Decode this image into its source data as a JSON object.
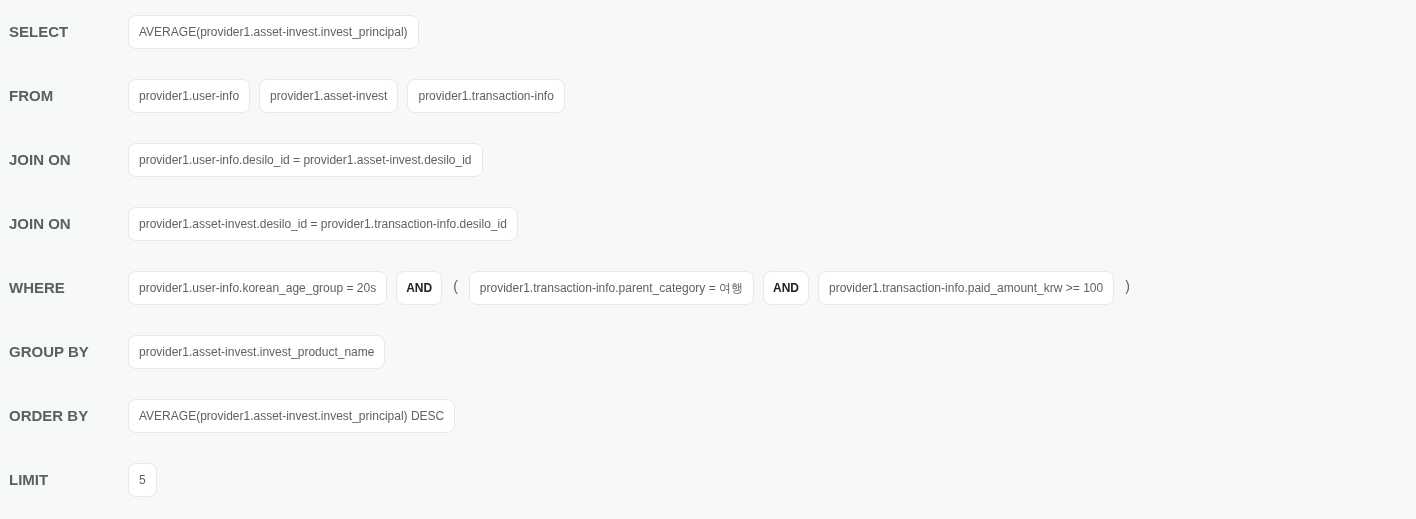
{
  "clauses": [
    {
      "keyword": "SELECT",
      "items": [
        {
          "kind": "chip",
          "text": "AVERAGE(provider1.asset-invest.invest_principal)"
        }
      ]
    },
    {
      "keyword": "FROM",
      "items": [
        {
          "kind": "chip",
          "text": "provider1.user-info"
        },
        {
          "kind": "chip",
          "text": "provider1.asset-invest"
        },
        {
          "kind": "chip",
          "text": "provider1.transaction-info"
        }
      ]
    },
    {
      "keyword": "JOIN ON",
      "items": [
        {
          "kind": "chip",
          "text": "provider1.user-info.desilo_id = provider1.asset-invest.desilo_id"
        }
      ]
    },
    {
      "keyword": "JOIN ON",
      "items": [
        {
          "kind": "chip",
          "text": "provider1.asset-invest.desilo_id = provider1.transaction-info.desilo_id"
        }
      ]
    },
    {
      "keyword": "WHERE",
      "items": [
        {
          "kind": "chip",
          "text": "provider1.user-info.korean_age_group = 20s"
        },
        {
          "kind": "operator",
          "text": "AND"
        },
        {
          "kind": "paren",
          "text": "("
        },
        {
          "kind": "chip",
          "text": "provider1.transaction-info.parent_category = 여행"
        },
        {
          "kind": "operator",
          "text": "AND"
        },
        {
          "kind": "chip",
          "text": "provider1.transaction-info.paid_amount_krw >= 100"
        },
        {
          "kind": "paren",
          "text": ")"
        }
      ]
    },
    {
      "keyword": "GROUP BY",
      "items": [
        {
          "kind": "chip",
          "text": "provider1.asset-invest.invest_product_name"
        }
      ]
    },
    {
      "keyword": "ORDER BY",
      "items": [
        {
          "kind": "chip",
          "text": "AVERAGE(provider1.asset-invest.invest_principal) DESC"
        }
      ]
    },
    {
      "keyword": "LIMIT",
      "items": [
        {
          "kind": "chip",
          "text": "5"
        }
      ]
    }
  ]
}
